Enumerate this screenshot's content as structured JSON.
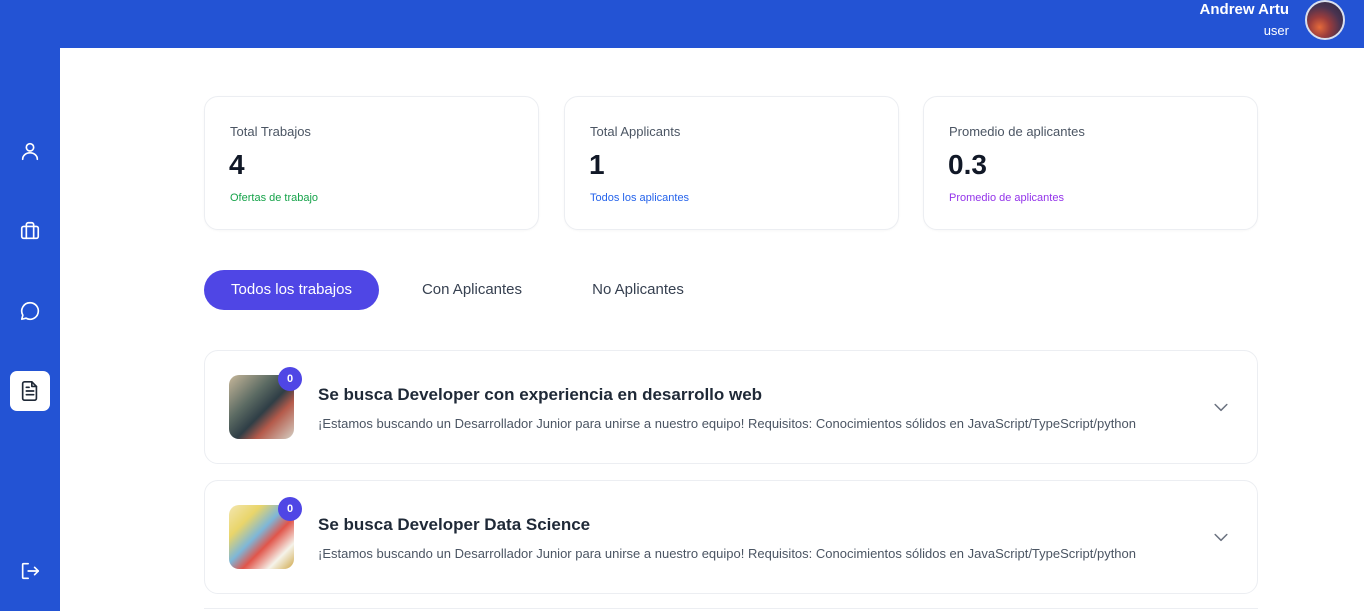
{
  "user": {
    "name": "Andrew Artu",
    "role": "user"
  },
  "sidebar": {
    "items": [
      {
        "icon": "user-icon"
      },
      {
        "icon": "briefcase-icon"
      },
      {
        "icon": "chat-icon"
      },
      {
        "icon": "document-icon",
        "active": true
      },
      {
        "icon": "logout-icon"
      }
    ]
  },
  "stats": [
    {
      "label": "Total Trabajos",
      "value": "4",
      "sub": "Ofertas de trabajo",
      "sub_color": "#16a34a"
    },
    {
      "label": "Total Applicants",
      "value": "1",
      "sub": "Todos los aplicantes",
      "sub_color": "#2563eb"
    },
    {
      "label": "Promedio de aplicantes",
      "value": "0.3",
      "sub": "Promedio de aplicantes",
      "sub_color": "#9333ea"
    }
  ],
  "tabs": [
    {
      "label": "Todos los trabajos",
      "active": true
    },
    {
      "label": "Con Aplicantes",
      "active": false
    },
    {
      "label": "No Aplicantes",
      "active": false
    }
  ],
  "jobs": [
    {
      "title": "Se busca Developer con experiencia en desarrollo web",
      "description": "¡Estamos buscando un Desarrollador Junior para unirse a nuestro equipo! Requisitos: Conocimientos sólidos en JavaScript/TypeScript/python",
      "applicants": "0"
    },
    {
      "title": "Se busca Developer Data Science",
      "description": "¡Estamos buscando un Desarrollador Junior para unirse a nuestro equipo! Requisitos: Conocimientos sólidos en JavaScript/TypeScript/python",
      "applicants": "0"
    }
  ],
  "colors": {
    "brand": "#2353d4",
    "accent": "#4f46e5"
  }
}
